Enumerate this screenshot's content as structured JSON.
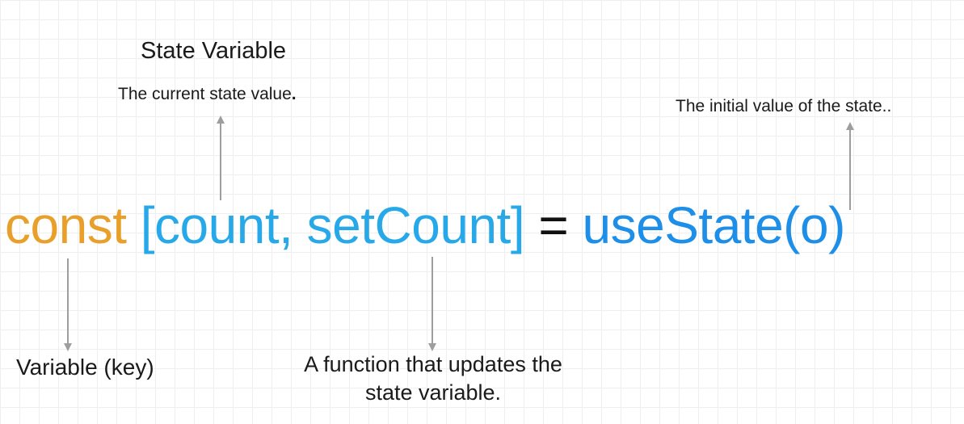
{
  "labels": {
    "state_variable_title": "State Variable",
    "state_variable_desc": "The current state value",
    "state_variable_desc_dot": ".",
    "initial_value_desc": "The initial value of the state..",
    "variable_key": "Variable (key)",
    "setter_desc": "A function that updates the state variable."
  },
  "code": {
    "keyword": "const",
    "destructure": "[count, setCount]",
    "operator": "=",
    "call": "useState(o)"
  },
  "colors": {
    "keyword": "#e8a02b",
    "destructure": "#27a8e8",
    "call": "#1d8fe8",
    "arrow": "#9e9e9e"
  }
}
